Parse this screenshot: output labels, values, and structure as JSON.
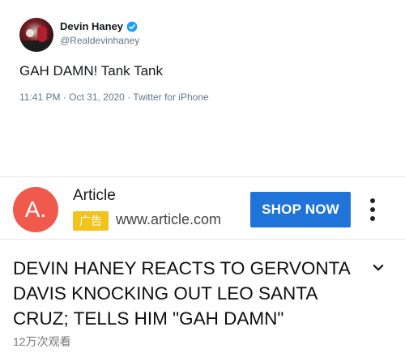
{
  "tweet": {
    "display_name": "Devin Haney",
    "handle": "@Realdevinhaney",
    "text": "GAH DAMN! Tank Tank",
    "meta": "11:41 PM · Oct 31, 2020 · Twitter for iPhone",
    "verified_color": "#1da1f2"
  },
  "ad": {
    "logo_letter": "A.",
    "logo_color": "#ef5a4c",
    "title": "Article",
    "badge": "广告",
    "badge_color": "#f2c318",
    "url": "www.article.com",
    "cta": "SHOP NOW",
    "cta_color": "#2073d8",
    "menu_icon": "kebab-menu-icon"
  },
  "video": {
    "title": "DEVIN HANEY REACTS TO GERVONTA DAVIS KNOCKING OUT LEO SANTA CRUZ; TELLS HIM \"GAH DAMN\"",
    "views": "12万次观看",
    "expand_icon": "chevron-down-icon"
  }
}
